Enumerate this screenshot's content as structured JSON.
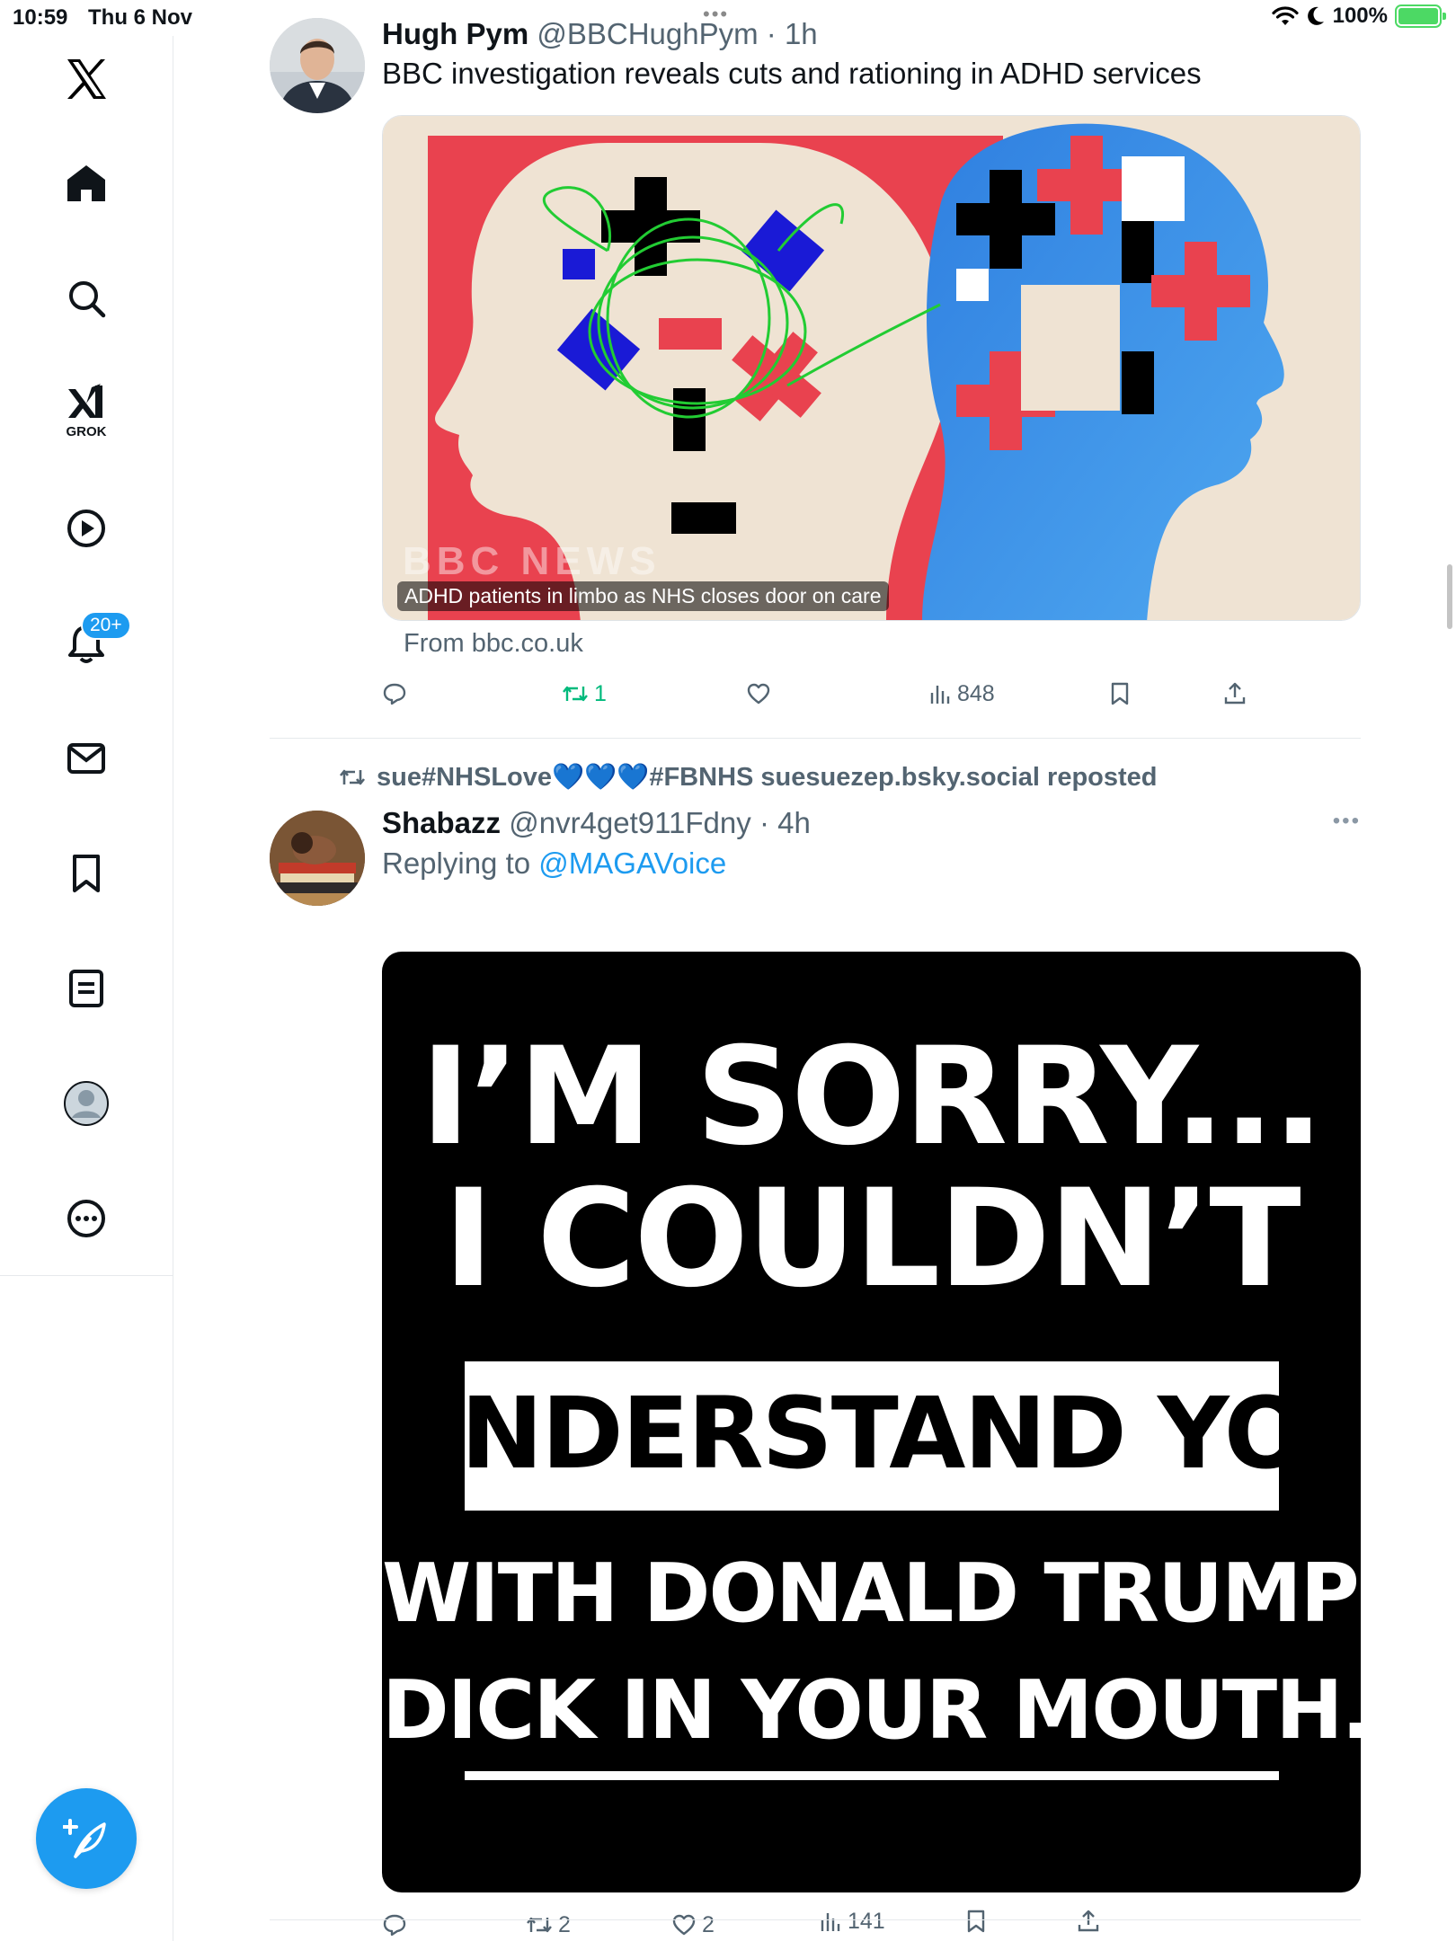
{
  "status_bar": {
    "time": "10:59",
    "date": "Thu 6 Nov",
    "battery": "100%"
  },
  "sidebar": {
    "items": [
      {
        "name": "x-logo"
      },
      {
        "name": "home"
      },
      {
        "name": "search"
      },
      {
        "name": "grok",
        "label": "GROK"
      },
      {
        "name": "video"
      },
      {
        "name": "notifications",
        "badge": "20+"
      },
      {
        "name": "messages"
      },
      {
        "name": "bookmarks"
      },
      {
        "name": "lists"
      },
      {
        "name": "profile"
      },
      {
        "name": "more"
      }
    ],
    "accent": "#1d9bf0"
  },
  "tweets": [
    {
      "name": "Hugh Pym",
      "handle": "@BBCHughPym",
      "time": "· 1h",
      "text": "BBC investigation reveals cuts and rationing in ADHD services",
      "card": {
        "caption": "ADHD patients in limbo as NHS closes door on care",
        "watermark": "BBC NEWS",
        "source": "From bbc.co.uk"
      },
      "actions": {
        "replies": "",
        "reposts": "1",
        "likes": "",
        "views": "848"
      }
    },
    {
      "repost_by": "sue#NHSLove💙💙💙#FBNHS suesuezep.bsky.social reposted",
      "name": "Shabazz",
      "handle": "@nvr4get911Fdny",
      "time": "· 4h",
      "replying_prefix": "Replying to",
      "replying_to": "@MAGAVoice",
      "meme_lines": [
        "I’M SORRY...",
        "I COULDN’T",
        "UNDERSTAND YOU",
        "WITH DONALD TRUMP’S",
        "DICK IN YOUR MOUTH."
      ],
      "actions": {
        "replies": "",
        "reposts": "2",
        "likes": "2",
        "views": "141"
      }
    }
  ]
}
